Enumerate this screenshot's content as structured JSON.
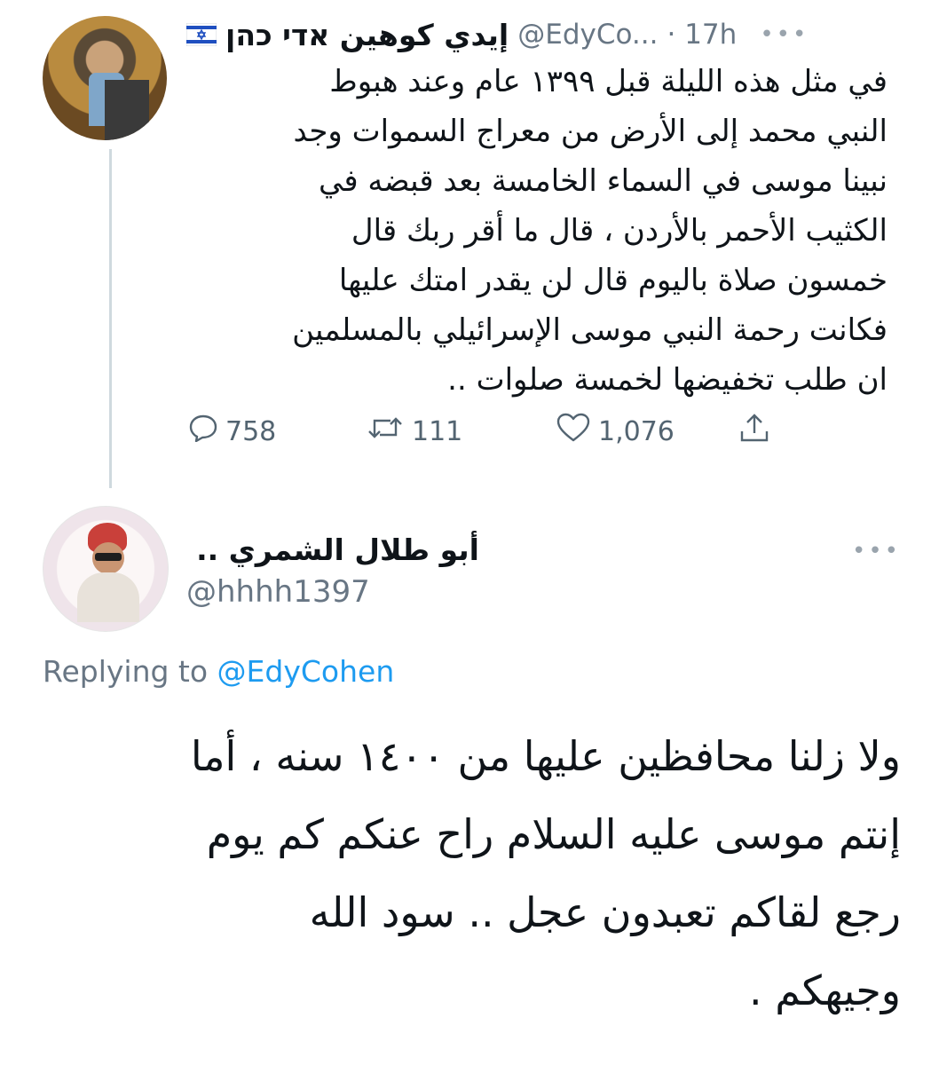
{
  "original_tweet": {
    "display_name": "إيدي كوهين אדי כהן",
    "flag_icon": "israel-flag-icon",
    "handle": "@EdyCo...",
    "time": "· 17h",
    "more_icon": "more-dots-icon",
    "lines": [
      "في مثل هذه الليلة قبل ١٣٩٩ عام وعند هبوط",
      "النبي محمد إلى الأرض من معراج السموات وجد",
      "نبينا موسى في السماء الخامسة بعد قبضه في",
      "الكثيب الأحمر بالأردن ، قال ما أقر ربك قال",
      "خمسون صلاة باليوم قال لن يقدر امتك عليها",
      "فكانت رحمة النبي موسى الإسرائيلي بالمسلمين",
      "ان طلب تخفيضها لخمسة صلوات .."
    ],
    "actions": {
      "reply_count": "758",
      "retweet_count": "111",
      "like_count": "1,076"
    }
  },
  "reply": {
    "display_name": "أبو طلال الشمري ..",
    "handle": "@hhhh1397",
    "replying_prefix": "Replying to",
    "replying_handle": "@EdyCohen",
    "lines": [
      "ولا زلنا محافظين عليها من ١٤٠٠ سنه ، أما",
      "إنتم موسى عليه السلام راح عنكم كم يوم",
      "رجع لقاكم تعبدون عجل .. سود الله",
      "وجيهكم ."
    ]
  },
  "colors": {
    "link": "#1d9bf0",
    "muted": "#687684",
    "text": "#0f1419"
  }
}
